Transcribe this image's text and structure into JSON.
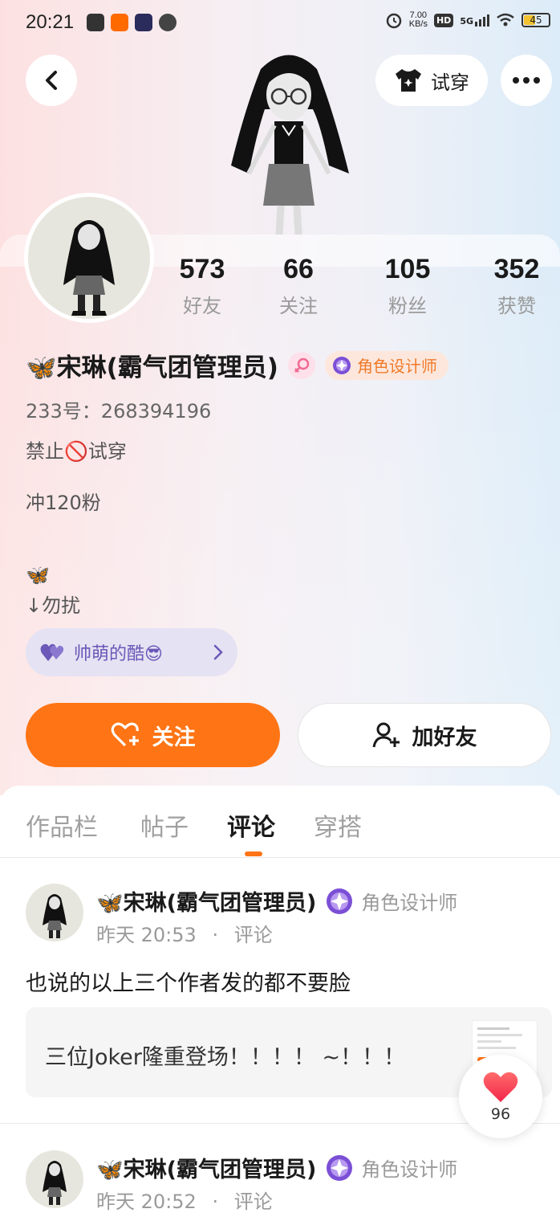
{
  "status_bar": {
    "time": "20:21",
    "net_speed_value": "7.00",
    "net_speed_unit": "KB/s",
    "hd": "HD",
    "signal": "5G",
    "battery": "45"
  },
  "header": {
    "try_on_label": "试穿"
  },
  "stats": [
    {
      "value": "573",
      "label": "好友"
    },
    {
      "value": "66",
      "label": "关注"
    },
    {
      "value": "105",
      "label": "粉丝"
    },
    {
      "value": "352",
      "label": "获赞"
    }
  ],
  "profile": {
    "name": "🦋宋琳(霸气团管理员)",
    "role": "角色设计师",
    "id_line": "233号：268394196",
    "bio_lines": [
      "禁止🚫试穿",
      "冲120粉",
      "🦋",
      "↓勿扰"
    ],
    "tag": "帅萌的酷😎"
  },
  "actions": {
    "follow_label": "关注",
    "add_friend_label": "加好友"
  },
  "tabs": [
    {
      "label": "作品栏",
      "active": false
    },
    {
      "label": "帖子",
      "active": false
    },
    {
      "label": "评论",
      "active": true
    },
    {
      "label": "穿搭",
      "active": false
    }
  ],
  "comments": [
    {
      "name": "🦋宋琳(霸气团管理员)",
      "role": "角色设计师",
      "time": "昨天 20:53",
      "type": "评论",
      "text": "也说的以上三个作者发的都不要脸",
      "quote": "三位Joker隆重登场！！！！ ~！！！"
    },
    {
      "name": "🦋宋琳(霸气团管理员)",
      "role": "角色设计师",
      "time": "昨天 20:52",
      "type": "评论"
    }
  ],
  "floating_like": {
    "count": "96"
  },
  "colors": {
    "accent": "#ff7414",
    "role_text": "#f07a2a",
    "tag_text": "#6b58b8"
  }
}
